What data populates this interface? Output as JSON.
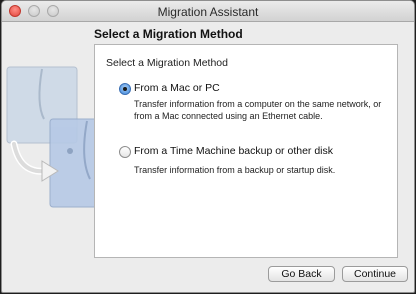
{
  "window": {
    "title": "Migration Assistant"
  },
  "page": {
    "heading": "Select a Migration Method"
  },
  "panel": {
    "title": "Select a Migration Method",
    "options": [
      {
        "label": "From a Mac or PC",
        "description_line1": "Transfer information from a computer on the same network, or",
        "description_line2": "from a Mac connected using an Ethernet cable.",
        "selected": true
      },
      {
        "label": "From a Time Machine backup or other disk",
        "description_line1": "Transfer information from a backup or startup disk.",
        "selected": false
      }
    ]
  },
  "buttons": {
    "back_label": "Go Back",
    "continue_label": "Continue"
  },
  "icons": {
    "window_controls": [
      "close-icon",
      "minimize-icon",
      "zoom-icon"
    ],
    "illustration": "migration-finder-icon"
  },
  "colors": {
    "radio_selected": "#3a86dc",
    "close_button": "#e2453c"
  }
}
